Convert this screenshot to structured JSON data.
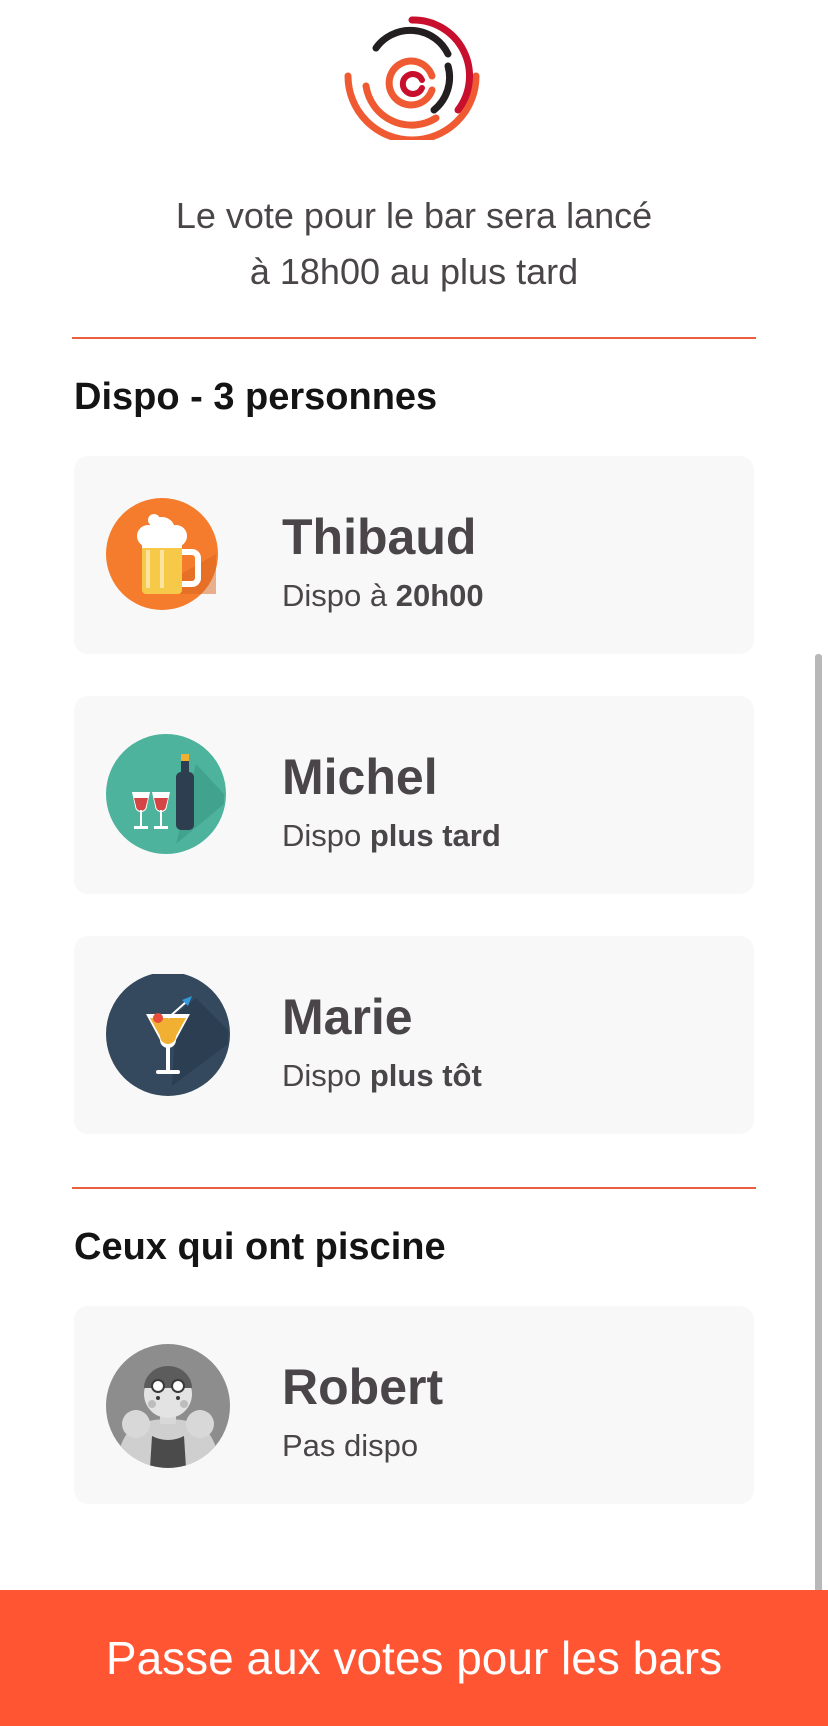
{
  "intro": {
    "line1": "Le vote pour le bar sera lancé",
    "line2": "à 18h00 au plus tard"
  },
  "sections": {
    "available": {
      "title": "Dispo - 3 personnes",
      "people": [
        {
          "name": "Thibaud",
          "status_prefix": "Dispo à ",
          "status_bold": "20h00",
          "icon": "beer-mug-icon"
        },
        {
          "name": "Michel",
          "status_prefix": "Dispo ",
          "status_bold": "plus tard",
          "icon": "wine-glasses-icon"
        },
        {
          "name": "Marie",
          "status_prefix": "Dispo ",
          "status_bold": "plus tôt",
          "icon": "cocktail-icon"
        }
      ]
    },
    "unavailable": {
      "title": "Ceux qui ont piscine",
      "people": [
        {
          "name": "Robert",
          "status_prefix": "Pas dispo",
          "status_bold": "",
          "icon": "swimmer-icon"
        }
      ]
    }
  },
  "cta": {
    "label": "Passe aux votes pour les bars"
  },
  "colors": {
    "accent": "#ff5533",
    "divider": "#e8603f",
    "card_bg": "#f8f8f8",
    "text": "#4a4548"
  }
}
